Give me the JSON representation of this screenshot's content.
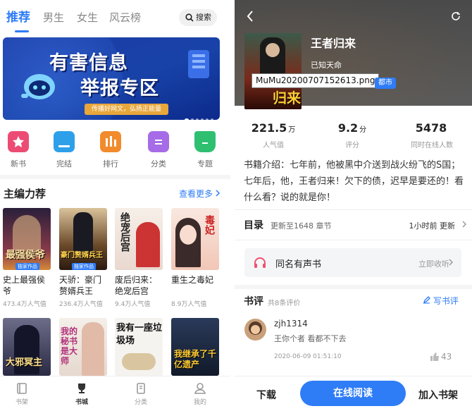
{
  "left": {
    "tabs": [
      {
        "label": "推荐",
        "active": true
      },
      {
        "label": "男生",
        "active": false
      },
      {
        "label": "女生",
        "active": false
      },
      {
        "label": "风云榜",
        "active": false
      }
    ],
    "search_label": "搜索",
    "banner": {
      "line1": "有害信息",
      "line2": "举报专区",
      "slogan": "传播好网文，弘扬正能量",
      "slide_count": 6,
      "active_slide": 0
    },
    "categories": [
      {
        "label": "新书",
        "icon": "new-book-icon",
        "color": "#ec4c74"
      },
      {
        "label": "完结",
        "icon": "finished-icon",
        "color": "#2ea0ea"
      },
      {
        "label": "排行",
        "icon": "ranking-icon",
        "color": "#f28b2c"
      },
      {
        "label": "分类",
        "icon": "category-icon",
        "color": "#a66ce8"
      },
      {
        "label": "专题",
        "icon": "topic-icon",
        "color": "#2fbf71"
      }
    ],
    "section": {
      "title": "主编力荐",
      "more": "查看更多"
    },
    "books": [
      {
        "title": "史上最强侯爷",
        "popularity": "473.4万人气值",
        "cover_text": "最强侯爷",
        "badge": "独家作品"
      },
      {
        "title": "天骄：豪门赘婿兵王",
        "popularity": "236.4万人气值",
        "cover_text": "豪门赘婿兵王",
        "badge": "独家作品"
      },
      {
        "title": "废后归来：绝宠后宫",
        "popularity": "9.4万人气值",
        "cover_text": "绝宠后宫",
        "badge": ""
      },
      {
        "title": "重生之毒妃",
        "popularity": "8.9万人气值",
        "cover_text": "毒妃",
        "badge": ""
      }
    ],
    "books_row2": [
      {
        "cover_text": "大邪冥主"
      },
      {
        "cover_text": "我的秘书是大师"
      },
      {
        "cover_text": "我有一座垃圾场"
      },
      {
        "cover_text": "我继承了千亿遗产"
      }
    ],
    "bottom_nav": [
      {
        "label": "书架",
        "icon": "bookshelf-icon",
        "active": false
      },
      {
        "label": "书城",
        "icon": "trophy-icon",
        "active": true
      },
      {
        "label": "分类",
        "icon": "category-nav-icon",
        "active": false
      },
      {
        "label": "我的",
        "icon": "profile-icon",
        "active": false
      }
    ]
  },
  "right": {
    "book": {
      "title": "王者归来",
      "author": "已知天命",
      "cover_text": "归来",
      "tooltip": "MuMu20200707152613.png",
      "tag": "都市"
    },
    "stats": [
      {
        "value": "221.5",
        "unit": "万",
        "label": "人气值"
      },
      {
        "value": "9.2",
        "unit": "分",
        "label": "评分"
      },
      {
        "value": "5478",
        "unit": "",
        "label": "同时在线人数"
      }
    ],
    "description": "书籍介绍：七年前，他被黑中介送到战火纷飞的S国；七年后，他，王者归来！欠下的债，迟早是要还的！看什么看？说的就是你！",
    "toc": {
      "title": "目录",
      "update": "更新至1648 章节",
      "time": "1小时前 更新"
    },
    "audio": {
      "label": "同名有声书",
      "action": "立即收听"
    },
    "reviews": {
      "title": "书评",
      "count": "共8条评价",
      "write": "写书评",
      "items": [
        {
          "user": "zjh1314",
          "text": "王你个者 看都不下去",
          "time": "2020-06-09 01:51:10",
          "likes": "43"
        }
      ]
    },
    "footer": {
      "download": "下载",
      "read": "在线阅读",
      "add": "加入书架"
    }
  }
}
